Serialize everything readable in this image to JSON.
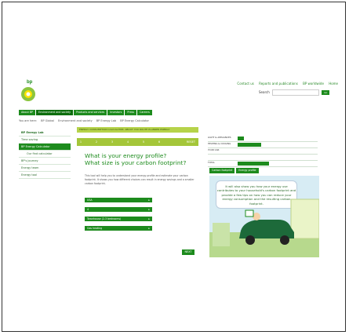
{
  "header": {
    "links": [
      "Contact us",
      "Reports and publications",
      "BP worldwide",
      "Home"
    ],
    "search_label": "Search",
    "search_placeholder": "",
    "go_label": "Go"
  },
  "nav": [
    "About BP",
    "Environment and society",
    "Products and services",
    "Investors",
    "Press",
    "Careers"
  ],
  "breadcrumb": [
    "You are here:",
    "BP Global",
    "Environment and society",
    "BP Energy Lab",
    "BP Energy Calculator"
  ],
  "sidebar": {
    "items": [
      "BP Energy Lab",
      "Time saving",
      "BP Energy Calculator",
      "Our find calculator",
      "BP's journey",
      "Energy team",
      "Energy tool"
    ]
  },
  "main": {
    "progress_label": "ENERGY CONSUMPTION CALCULATOR: ABOUT YOU  ROUTE PLANNER  ENERGY",
    "steps": [
      "1",
      "2",
      "3",
      "4",
      "5",
      "6"
    ],
    "reset_label": "RESET",
    "question_line1": "What is your energy profile?",
    "question_line2": "What size is your carbon footprint?",
    "intro": "This tool will help you to understand your energy profile and estimate your carbon footprint. It shows you how different choices can result in energy savings and a smaller carbon footprint.",
    "options": [
      "USA",
      "4",
      "Townhouse (2-3 bedrooms)",
      "Gas heating"
    ],
    "next_label": "NEXT"
  },
  "chart_panel": {
    "rows": [
      "LIGHT & APPLIANCES",
      "HEATING & COOLING",
      "YOUR CAR",
      "",
      "TOTAL"
    ]
  },
  "right_tabs": [
    "Carbon footprint",
    "Energy profile"
  ],
  "bubble_text": "It will also show you how your energy use contributes to your household's carbon footprint and provide a few tips on how you can reduce your energy consumption and the resulting carbon footprint."
}
